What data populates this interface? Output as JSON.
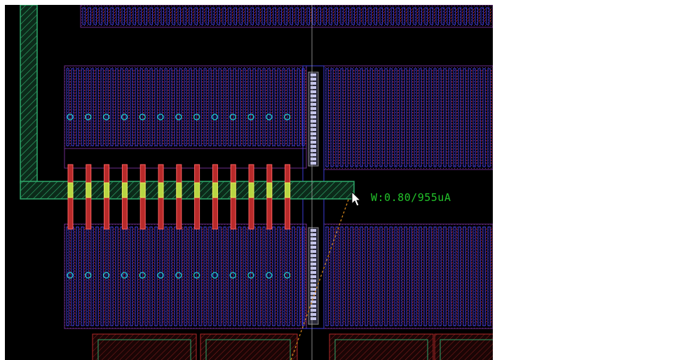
{
  "view": {
    "background": "#000000",
    "page_background": "#ffffff"
  },
  "measurement": {
    "label": "W:0.80/955uA",
    "color": "#22c32a"
  },
  "layers": {
    "metal1": "#3b3bd6",
    "poly": "#b82a2a",
    "diffusion": "#6b2d8a",
    "metal2_wire": "#2ea86a",
    "contact": "#c6c6ee",
    "via_cut": "#22d0d0",
    "crosshair": "#bbbbbb",
    "ruler": "#d4861c"
  },
  "icons": {
    "cursor": "arrow-pointer-icon"
  }
}
